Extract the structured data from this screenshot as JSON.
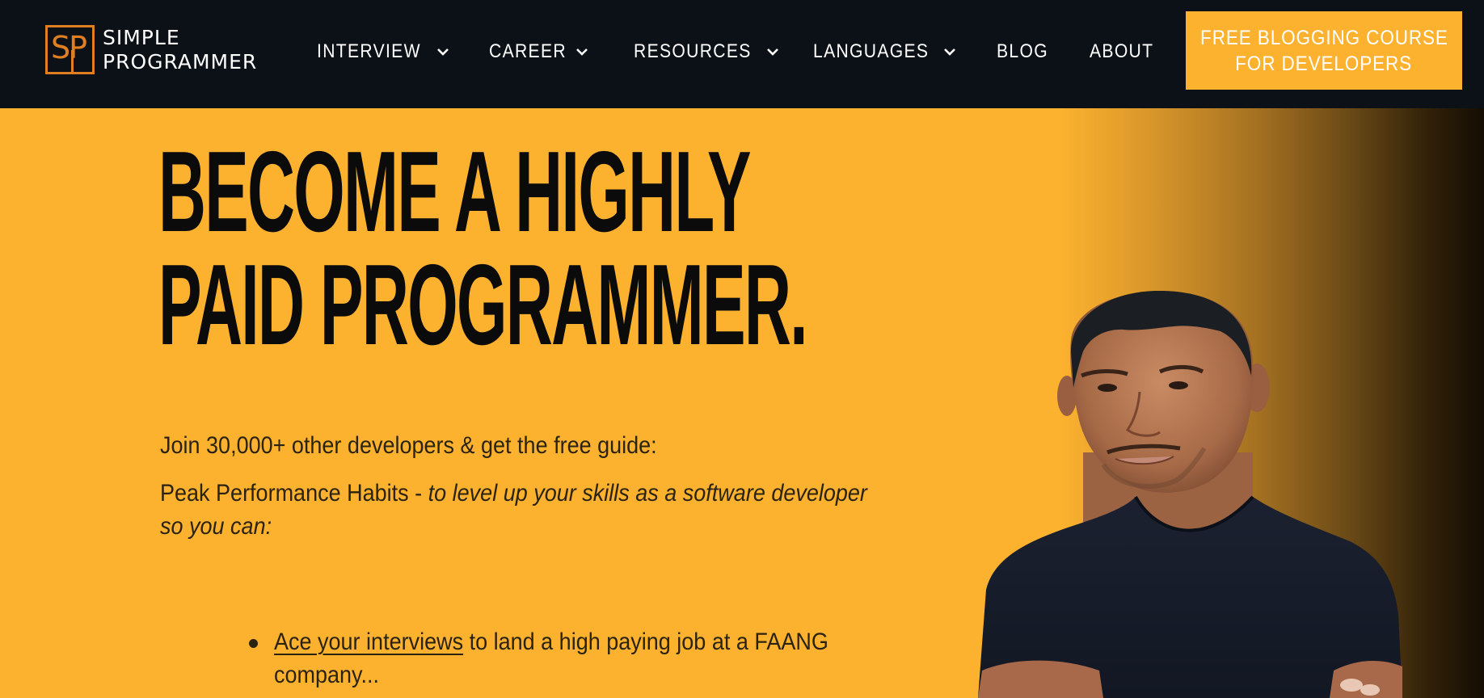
{
  "header": {
    "logo": {
      "line1": "SIMPLE",
      "line2": "PROGRAMMER",
      "monogram": "SP",
      "icon": "sp-logo-icon"
    },
    "nav": [
      {
        "label": "INTERVIEW",
        "has_dropdown": true
      },
      {
        "label": "CAREER",
        "has_dropdown": true
      },
      {
        "label": "RESOURCES",
        "has_dropdown": true
      },
      {
        "label": "LANGUAGES",
        "has_dropdown": true
      },
      {
        "label": "BLOG",
        "has_dropdown": false
      },
      {
        "label": "ABOUT",
        "has_dropdown": false
      }
    ],
    "cta": {
      "line1": "FREE BLOGGING COURSE",
      "line2": "FOR DEVELOPERS"
    }
  },
  "hero": {
    "headline": {
      "line1": "BECOME A HIGHLY",
      "line2": "PAID PROGRAMMER."
    },
    "join_text": "Join 30,000+ other developers & get the free guide:",
    "guide_name": "Peak Performance Habits",
    "guide_separator": " - ",
    "guide_tagline": "to level up your skills as a software developer so you can:",
    "bullets": [
      {
        "link_text": "Ace your interviews",
        "rest_text": " to land a high paying job at a FAANG company..."
      }
    ],
    "portrait": "person-portrait-image"
  },
  "colors": {
    "header_bg": "#0C1117",
    "brand_yellow": "#FDB22F",
    "logo_orange": "#E07F21",
    "headline_text": "#0B0B0B",
    "body_text": "#2B2311",
    "nav_text": "#FFFFFF"
  }
}
